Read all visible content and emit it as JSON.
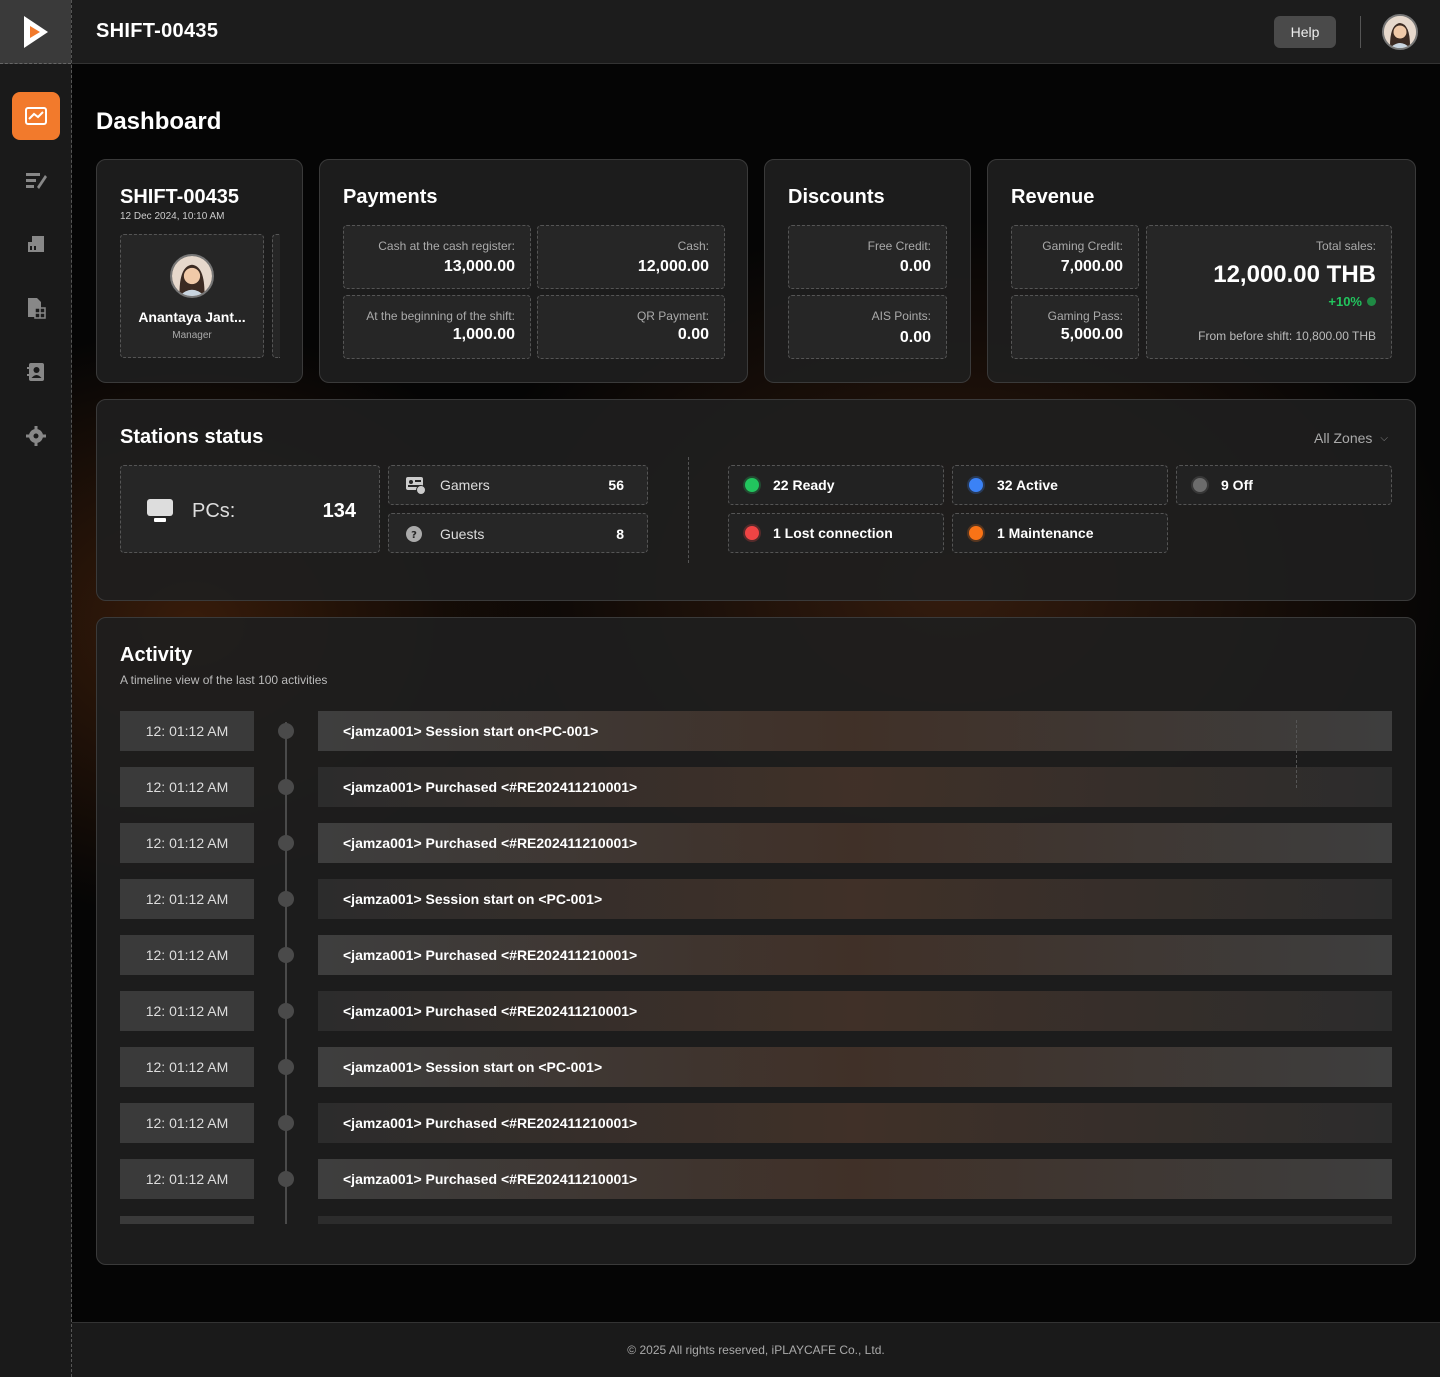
{
  "header": {
    "title": "SHIFT-00435",
    "help_label": "Help"
  },
  "sidebar": {
    "items": [
      {
        "icon": "chart-line-icon",
        "active": true
      },
      {
        "icon": "edit-list-icon"
      },
      {
        "icon": "cash-register-icon"
      },
      {
        "icon": "document-grid-icon"
      },
      {
        "icon": "user-card-icon"
      },
      {
        "icon": "gear-icon"
      }
    ]
  },
  "page": {
    "title": "Dashboard"
  },
  "shift_card": {
    "title": "SHIFT-00435",
    "date": "12 Dec 2024, 10:10 AM",
    "user_name": "Anantaya Jant...",
    "user_role": "Manager"
  },
  "payments": {
    "title": "Payments",
    "cash_register_label": "Cash at the cash register:",
    "cash_register_value": "13,000.00",
    "cash_label": "Cash:",
    "cash_value": "12,000.00",
    "beginning_label": "At the beginning of the shift:",
    "beginning_value": "1,000.00",
    "qr_label": "QR Payment:",
    "qr_value": "0.00"
  },
  "discounts": {
    "title": "Discounts",
    "free_credit_label": "Free Credit:",
    "free_credit_value": "0.00",
    "ais_label": "AIS Points:",
    "ais_value": "0.00"
  },
  "revenue": {
    "title": "Revenue",
    "gaming_credit_label": "Gaming Credit:",
    "gaming_credit_value": "7,000.00",
    "gaming_pass_label": "Gaming Pass:",
    "gaming_pass_value": "5,000.00",
    "total_label": "Total sales:",
    "total_value": "12,000.00 THB",
    "change": "+10%",
    "from_before": "From before shift: 10,800.00 THB"
  },
  "stations": {
    "title": "Stations status",
    "zone_filter": "All Zones",
    "pcs_label": "PCs:",
    "pcs_value": "134",
    "gamers_label": "Gamers",
    "gamers_value": "56",
    "guests_label": "Guests",
    "guests_value": "8",
    "ready": "22 Ready",
    "active": "32 Active",
    "off": "9 Off",
    "lost": "1 Lost connection",
    "maintenance": "1 Maintenance",
    "colors": {
      "ready": "#22c55e",
      "active": "#3b82f6",
      "off": "#6b6b6b",
      "lost": "#ef4444",
      "maintenance": "#f97316"
    }
  },
  "activity": {
    "title": "Activity",
    "subtitle": "A timeline view of the last 100 activities",
    "items": [
      {
        "time": "12: 01:12 AM",
        "text": "<jamza001> Session start on<PC-001>"
      },
      {
        "time": "12: 01:12 AM",
        "text": "<jamza001> Purchased <#RE202411210001>"
      },
      {
        "time": "12: 01:12 AM",
        "text": "<jamza001> Purchased <#RE202411210001>"
      },
      {
        "time": "12: 01:12 AM",
        "text": "<jamza001> Session start on <PC-001>"
      },
      {
        "time": "12: 01:12 AM",
        "text": "<jamza001> Purchased <#RE202411210001>"
      },
      {
        "time": "12: 01:12 AM",
        "text": "<jamza001> Purchased <#RE202411210001>"
      },
      {
        "time": "12: 01:12 AM",
        "text": "<jamza001> Session start on <PC-001>"
      },
      {
        "time": "12: 01:12 AM",
        "text": "<jamza001> Purchased <#RE202411210001>"
      },
      {
        "time": "12: 01:12 AM",
        "text": "<jamza001> Purchased <#RE202411210001>"
      }
    ]
  },
  "footer": {
    "text": "© 2025 All rights reserved, iPLAYCAFE Co., Ltd."
  }
}
